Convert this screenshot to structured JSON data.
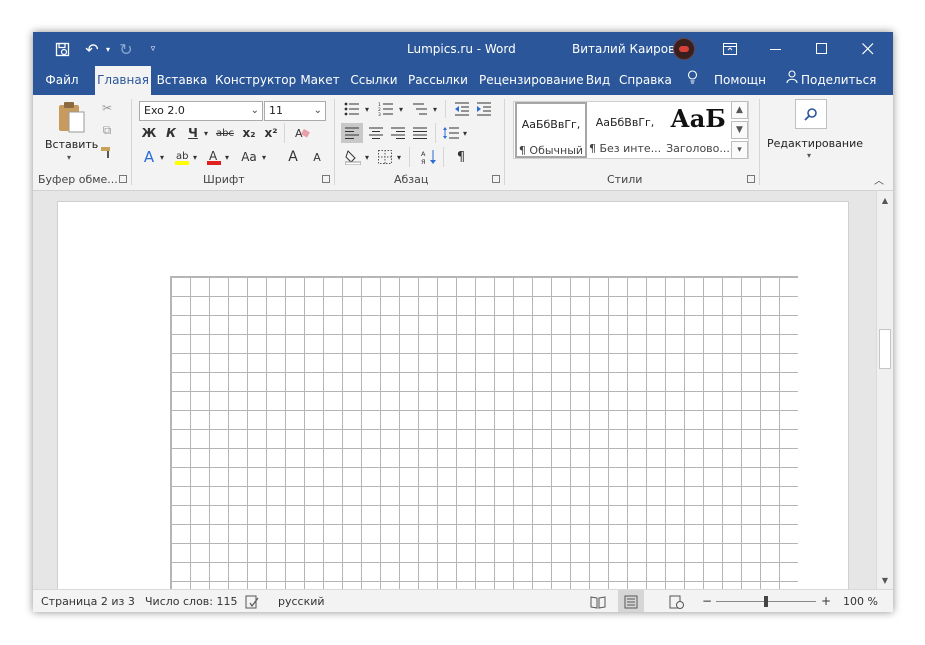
{
  "colors": {
    "accent": "#2b579a",
    "ribbon_bg": "#f3f3f3",
    "grid_lines": "#b5b5b5"
  },
  "quick_access": {
    "save_icon": "save-icon",
    "undo_icon": "undo-icon",
    "redo_icon": "redo-icon",
    "customize_icon": "chevron-down-icon"
  },
  "title": {
    "document": "Lumpics.ru  -  Word",
    "user": "Виталий Каиров"
  },
  "window_controls": {
    "ribbon_display": "ribbon-display-icon",
    "minimize": "minimize-icon",
    "maximize": "maximize-icon",
    "close": "close-icon"
  },
  "tabs": [
    "Файл",
    "Главная",
    "Вставка",
    "Конструктор",
    "Макет",
    "Ссылки",
    "Рассылки",
    "Рецензирование",
    "Вид",
    "Справка",
    "Помощн",
    "Поделиться"
  ],
  "active_tab": "Главная",
  "ribbon": {
    "clipboard": {
      "paste_label": "Вставить",
      "group_label": "Буфер обме..."
    },
    "font": {
      "font_name": "Exo 2.0",
      "font_size": "11",
      "group_label": "Шрифт",
      "bold": "Ж",
      "italic": "К",
      "underline": "Ч",
      "strike": "abc",
      "subscript": "x₂",
      "superscript": "x²",
      "grow": "A",
      "shrink": "A",
      "case": "Aa"
    },
    "paragraph": {
      "group_label": "Абзац",
      "pilcrow": "¶"
    },
    "styles": {
      "group_label": "Стили",
      "items": [
        {
          "preview": "АаБбВвГг,",
          "label": "¶ Обычный"
        },
        {
          "preview": "АаБбВвГг,",
          "label": "¶ Без инте..."
        },
        {
          "preview": "АаБ",
          "label": "Заголово..."
        }
      ]
    },
    "editing": {
      "label": "Редактирование"
    }
  },
  "status_bar": {
    "page": "Страница 2 из 3",
    "words": "Число слов: 115",
    "language": "русский",
    "zoom": "100 %",
    "zoom_minus": "−",
    "zoom_plus": "+",
    "zoom_level": 1.0
  }
}
